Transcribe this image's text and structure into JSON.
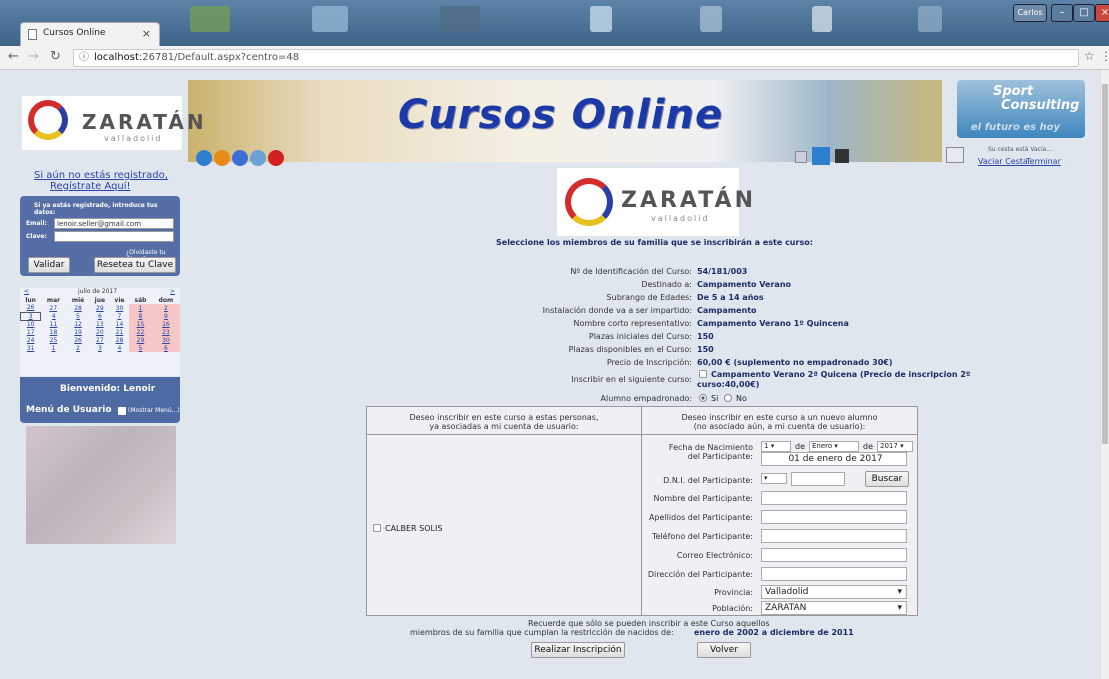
{
  "browser": {
    "tab_title": "Cursos Online",
    "url_host": "localhost",
    "url_rest": ":26781/Default.aspx?centro=48",
    "window_user": "Carlos"
  },
  "header": {
    "banner_title": "Cursos Online",
    "logo_text": "ZARATÁN",
    "logo_sub": "valladolid",
    "partner_top": "Sport",
    "partner_bottom": "Consulting",
    "partner_tagline": "el futuro es hoy"
  },
  "cart": {
    "status": "Su cesta está Vacía...",
    "empty_link": "Vaciar Cesta",
    "finish_link": "Terminar"
  },
  "login": {
    "register_line1": "Si aún no estás registrado,",
    "register_line2": "Regístrate Aquí!",
    "title": "Si ya estás registrado, introduce tus datos:",
    "email_label": "Email:",
    "email_value": "lenoir.seller@gmail.com",
    "password_label": "Clave:",
    "forgot_link": "¿Olvidaste tu Clave?",
    "validate_button": "Validar",
    "reset_button": "Resetea tu Clave"
  },
  "calendar": {
    "prev": "<",
    "next": ">",
    "month": "julio de 2017",
    "days": [
      "lun",
      "mar",
      "mié",
      "jue",
      "vie",
      "sáb",
      "dom"
    ],
    "weeks": [
      [
        "26",
        "27",
        "28",
        "29",
        "30",
        "1",
        "2"
      ],
      [
        "3",
        "4",
        "5",
        "6",
        "7",
        "8",
        "9"
      ],
      [
        "10",
        "11",
        "12",
        "13",
        "14",
        "15",
        "16"
      ],
      [
        "17",
        "18",
        "19",
        "20",
        "21",
        "22",
        "23"
      ],
      [
        "24",
        "25",
        "26",
        "27",
        "28",
        "29",
        "30"
      ],
      [
        "31",
        "1",
        "2",
        "3",
        "4",
        "5",
        "6"
      ]
    ]
  },
  "welcome": {
    "greeting": "Bienvenido: Lenoir",
    "menu_label": "Menú de Usuario",
    "show_menu": "(Mostrar Menú...)"
  },
  "main": {
    "heading": "Seleccione los miembros de su familia que se inscribirán a este curso:",
    "fields": [
      {
        "label": "Nº de Identificación del Curso:",
        "value": "54/181/003"
      },
      {
        "label": "Destinado a:",
        "value": "Campamento Verano"
      },
      {
        "label": "Subrango de Edades:",
        "value": "De 5 a 14 años"
      },
      {
        "label": "Instalación donde va a ser impartido:",
        "value": "Campamento"
      },
      {
        "label": "Nombre corto representativo:",
        "value": "Campamento Verano 1º Quincena"
      },
      {
        "label": "Plazas iniciales del Curso:",
        "value": "150"
      },
      {
        "label": "Plazas disponibles en el Curso:",
        "value": "150"
      },
      {
        "label": "Precio de Inscripción:",
        "value": "60,00 € (suplemento no empadronado 30€)"
      }
    ],
    "extra_course_label": "Inscribir en el siguiente curso:",
    "extra_course_line1": "Campamento Verano 2ª Quicena (Precio de inscripcion 2º",
    "extra_course_line2": "curso:40,00€)",
    "empadronado_label": "Alumno empadronado:",
    "option_yes": "Si",
    "option_no": "No",
    "left_header_1": "Deseo inscribir en este curso a estas personas,",
    "left_header_2": "ya asociadas a mi cuenta de usuario:",
    "right_header_1": "Deseo inscribir en este curso a un nuevo alumno",
    "right_header_2": "(no asociado aún, a mi cuenta de usuario):",
    "member_name": "CALBER SOLIS",
    "birth_label_1": "Fecha de Nacimiento",
    "birth_label_2": "del Participante:",
    "day_value": "1",
    "de_1": "de",
    "month_value": "Enero",
    "de_2": "de",
    "year_value": "2017",
    "birth_text": "01 de enero de 2017",
    "dni_label": "D.N.I. del Participante:",
    "search_button": "Buscar",
    "name_label": "Nombre del Participante:",
    "surname_label": "Apellidos del Participante:",
    "phone_label": "Teléfono del Participante:",
    "email_label": "Correo Electrónico:",
    "address_label": "Dirección del Participante:",
    "province_label": "Provincia:",
    "province_value": "Valladolid",
    "town_label": "Población:",
    "town_value": "ZARATAN",
    "notice_1": "Recuerde que sólo se pueden inscribir a este Curso aquellos",
    "notice_2": "miembros de su familia que cumplan la restricción de nacidos de:",
    "notice_range": "enero de 2002 a diciembre de 2011",
    "submit_button": "Realizar Inscripción",
    "back_button": "Volver"
  },
  "colors": {
    "accent": "#556fa6",
    "title": "#1b3aa8"
  }
}
